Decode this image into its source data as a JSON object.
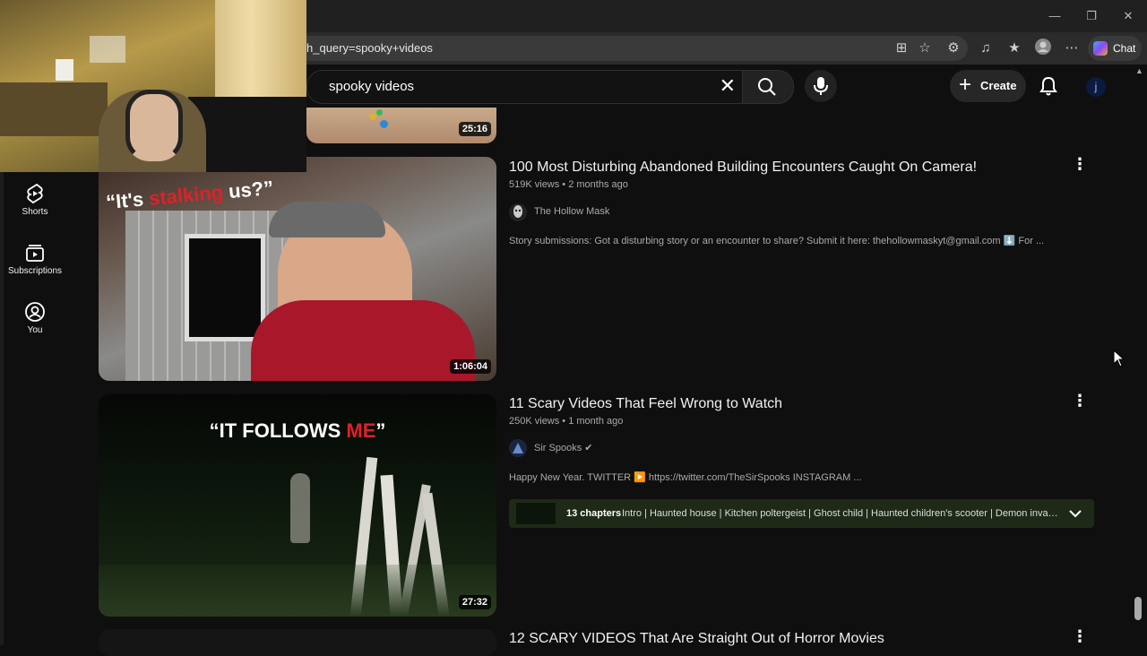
{
  "browser": {
    "url": "h_query=spooky+videos",
    "chat_label": "Chat",
    "window_controls": [
      "—",
      "❐",
      "✕"
    ]
  },
  "header": {
    "search_value": "spooky videos",
    "create_label": "Create",
    "avatar_letter": "j"
  },
  "sidebar": {
    "items": [
      {
        "label": "Shorts",
        "icon": "shorts-icon"
      },
      {
        "label": "Subscriptions",
        "icon": "subscriptions-icon"
      },
      {
        "label": "You",
        "icon": "you-icon"
      }
    ]
  },
  "results": [
    {
      "duration": "25:16"
    },
    {
      "title": "100 Most Disturbing Abandoned Building Encounters Caught On Camera!",
      "meta": "519K views • 2 months ago",
      "channel": "The Hollow Mask",
      "description": "Story submissions: Got a disturbing story or an encounter to share? Submit it here: thehollowmaskyt@gmail.com ⬇️ For ...",
      "duration": "1:06:04",
      "thumb_caption_a": "“It's ",
      "thumb_caption_b": "stalking",
      "thumb_caption_c": " us?”"
    },
    {
      "title": "11 Scary Videos That Feel Wrong to Watch",
      "meta": "250K views • 1 month ago",
      "channel": "Sir Spooks",
      "description": "Happy New Year. TWITTER ▶️ https://twitter.com/TheSirSpooks INSTAGRAM ...",
      "duration": "27:32",
      "thumb_caption_a": "“IT FOLLOWS ",
      "thumb_caption_b": "ME",
      "thumb_caption_c": "”",
      "chapters_count": "13 chapters",
      "chapters_list": "Intro | Haunted house | Kitchen poltergeist | Ghost child | Haunted children's scooter | Demon invades..."
    },
    {
      "title": "12 SCARY VIDEOS That Are Straight Out of Horror Movies"
    }
  ],
  "colors": {
    "accent_red": "#e0202a",
    "background": "#0f0f0f"
  }
}
